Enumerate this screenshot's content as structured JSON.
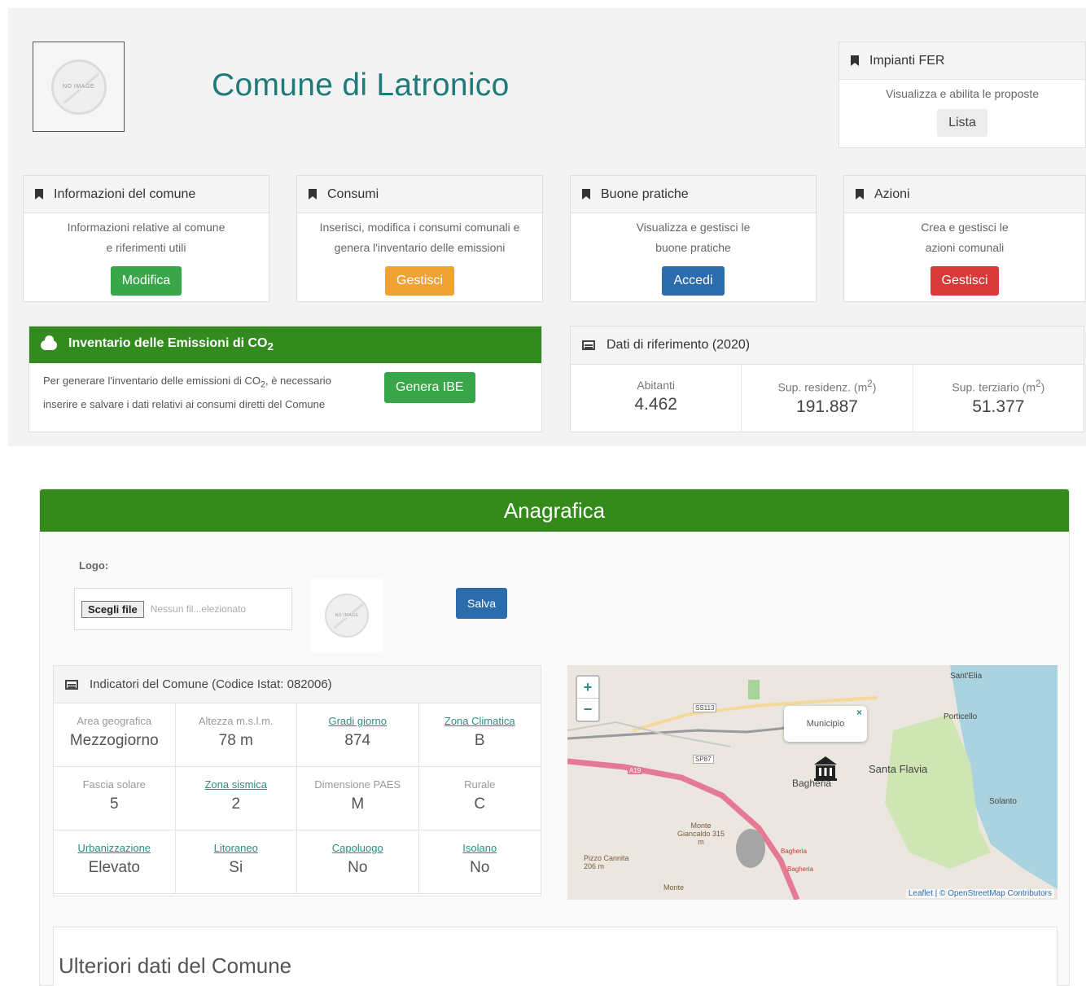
{
  "header": {
    "title": "Comune di Latronico",
    "logo_placeholder": "NO IMAGE"
  },
  "cards": [
    {
      "title": "Impianti FER",
      "text1": "Visualizza e abilita le proposte",
      "text2": "",
      "button": "Lista",
      "button_color": "#ececec"
    },
    {
      "title": "Informazioni del comune",
      "text1": "Informazioni relative al comune",
      "text2": "e riferimenti utili",
      "button": "Modifica",
      "button_color": "#3aa64a"
    },
    {
      "title": "Consumi",
      "text1": "Inserisci, modifica i consumi comunali e",
      "text2": "genera l'inventario delle emissioni",
      "button": "Gestisci",
      "button_color": "#f0a332"
    },
    {
      "title": "Buone pratiche",
      "text1": "Visualizza e gestisci le",
      "text2": "buone pratiche",
      "button": "Accedi",
      "button_color": "#2b6cad"
    },
    {
      "title": "Azioni",
      "text1": "Crea e gestisci le",
      "text2": "azioni comunali",
      "button": "Gestisci",
      "button_color": "#d83a3a"
    }
  ],
  "inventario": {
    "title_prefix": "Inventario delle Emissioni di CO",
    "title_sub": "2",
    "text_a": "Per generare l'inventario delle emissioni di CO",
    "text_sub": "2",
    "text_b": ", è necessario inserire e salvare i dati relativi ai consumi diretti del Comune",
    "button": "Genera IBE"
  },
  "dati": {
    "title": "Dati di riferimento (2020)",
    "items": [
      {
        "label": "Abitanti",
        "unit": "",
        "sup": "",
        "unit_end": "",
        "value": "4.462"
      },
      {
        "label": "Sup. residenz.",
        "unit": " (m",
        "sup": "2",
        "unit_end": ")",
        "value": "191.887"
      },
      {
        "label": "Sup. terziario",
        "unit": " (m",
        "sup": "2",
        "unit_end": ")",
        "value": "51.377"
      }
    ]
  },
  "anagrafica": {
    "title": "Anagrafica",
    "logo_label": "Logo:",
    "file_button": "Scegli file",
    "file_text": "Nessun fil...elezionato",
    "thumb_placeholder": "NO IMAGE",
    "save_button": "Salva",
    "indicators_title": "Indicatori del Comune (Codice Istat: 082006)",
    "indicators": [
      {
        "label": "Area geografica",
        "value": "Mezzogiorno"
      },
      {
        "label": "Altezza m.s.l.m.",
        "value": "78 m"
      },
      {
        "label": "Gradi giorno",
        "value": "874"
      },
      {
        "label": "Zona Climatica",
        "value": "B"
      },
      {
        "label": "Fascia solare",
        "value": "5"
      },
      {
        "label": "Zona sismica",
        "value": "2"
      },
      {
        "label": "Dimensione PAES",
        "value": "M"
      },
      {
        "label": "Rurale",
        "value": "C"
      },
      {
        "label": "Urbanizzazione",
        "value": "Elevato"
      },
      {
        "label": "Litoraneo",
        "value": "Si"
      },
      {
        "label": "Capoluogo",
        "value": "No"
      },
      {
        "label": "Isolano",
        "value": "No"
      }
    ],
    "map": {
      "zoom_in": "+",
      "zoom_out": "−",
      "popup": "Municipio",
      "popup_close": "×",
      "labels": [
        "Sant'Elia",
        "Porticello",
        "Santa Flavia",
        "Bagheria",
        "Solanto",
        "SS113",
        "SP87",
        "A19",
        "Monte Giancaldo 315 m",
        "Pizzo Cannita 206 m",
        "Monte",
        "Bagheria",
        "Bagheria"
      ],
      "attribution": "Leaflet | © OpenStreetMap Contributors"
    },
    "more_title": "Ulteriori dati del Comune"
  }
}
